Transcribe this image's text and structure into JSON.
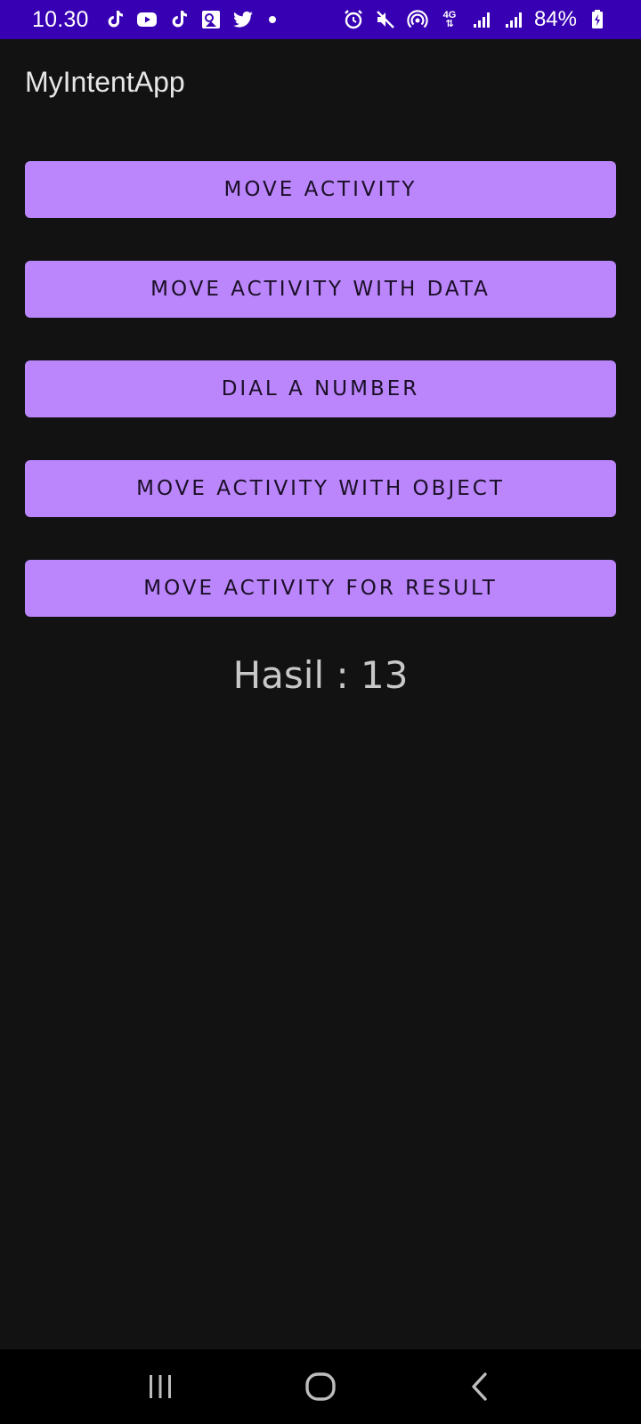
{
  "status_bar": {
    "time": "10.30",
    "network": "4G",
    "battery": "84%",
    "icons": [
      "tiktok-icon",
      "youtube-icon",
      "tiktok-icon",
      "gallery-icon",
      "twitter-icon",
      "alarm-icon",
      "mute-icon",
      "hotspot-icon",
      "signal-icon",
      "battery-icon"
    ],
    "background_color": "#3700b3"
  },
  "app_bar": {
    "title": "MyIntentApp"
  },
  "buttons": [
    {
      "label": "MOVE ACTIVITY"
    },
    {
      "label": "MOVE ACTIVITY WITH DATA"
    },
    {
      "label": "DIAL A NUMBER"
    },
    {
      "label": "MOVE ACTIVITY WITH OBJECT"
    },
    {
      "label": "MOVE ACTIVITY FOR RESULT"
    }
  ],
  "result_text": "Hasil : 13",
  "colors": {
    "accent": "#bb86fc",
    "background": "#121212",
    "nav_bar": "#000000"
  },
  "nav_bar": {
    "icons": [
      "recent-apps-icon",
      "home-icon",
      "back-icon"
    ]
  }
}
